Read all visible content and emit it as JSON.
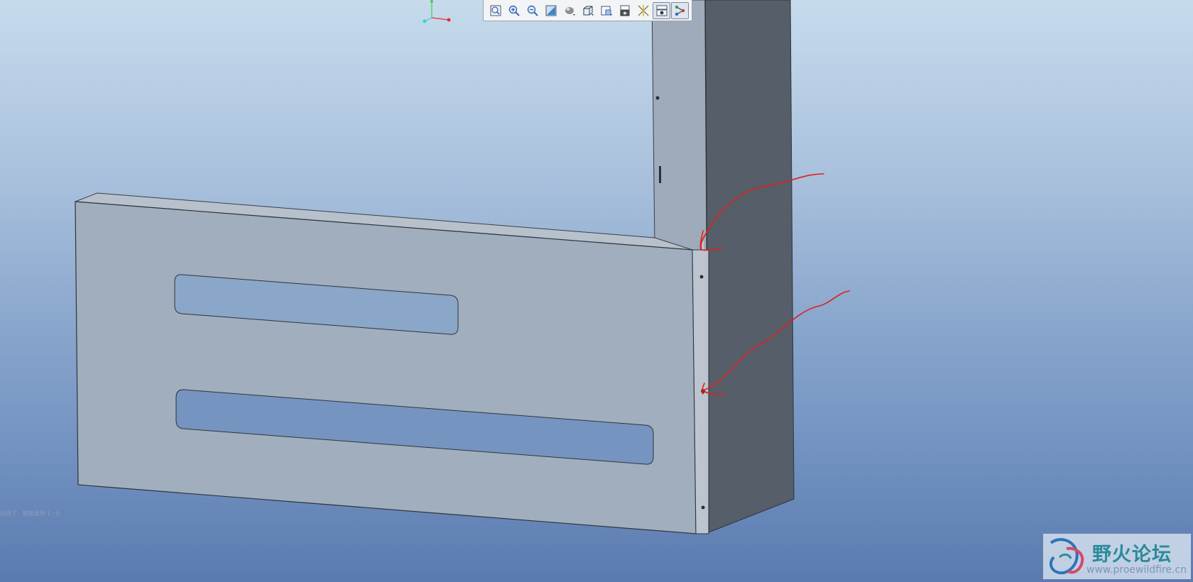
{
  "toolbar": {
    "buttons": [
      {
        "icon": "refit-icon"
      },
      {
        "icon": "zoom-in-icon"
      },
      {
        "icon": "zoom-out-icon"
      },
      {
        "icon": "repaint-icon"
      },
      {
        "icon": "display-style-icon"
      },
      {
        "icon": "saved-orientation-icon"
      },
      {
        "icon": "view-manager-icon"
      },
      {
        "icon": "datum-display-icon"
      },
      {
        "icon": "spin-center-icon"
      },
      {
        "icon": "annotation-display-icon"
      },
      {
        "icon": "model-tree-display-icon"
      }
    ]
  },
  "status": {
    "text": "选择了 · 智能选择 1 · 0"
  },
  "watermark": {
    "title": "野火论坛",
    "url": "www.proewildfire.cn"
  },
  "colors": {
    "background_top": "#c6dbec",
    "background_bottom": "#5b7bb0",
    "panel_face": "#a0aebd",
    "side_panel": "#565e6a",
    "annotation_red": "#e0201c",
    "axis_x": "#e5302a",
    "axis_y": "#3ed04a",
    "axis_z": "#2fd6d6"
  }
}
